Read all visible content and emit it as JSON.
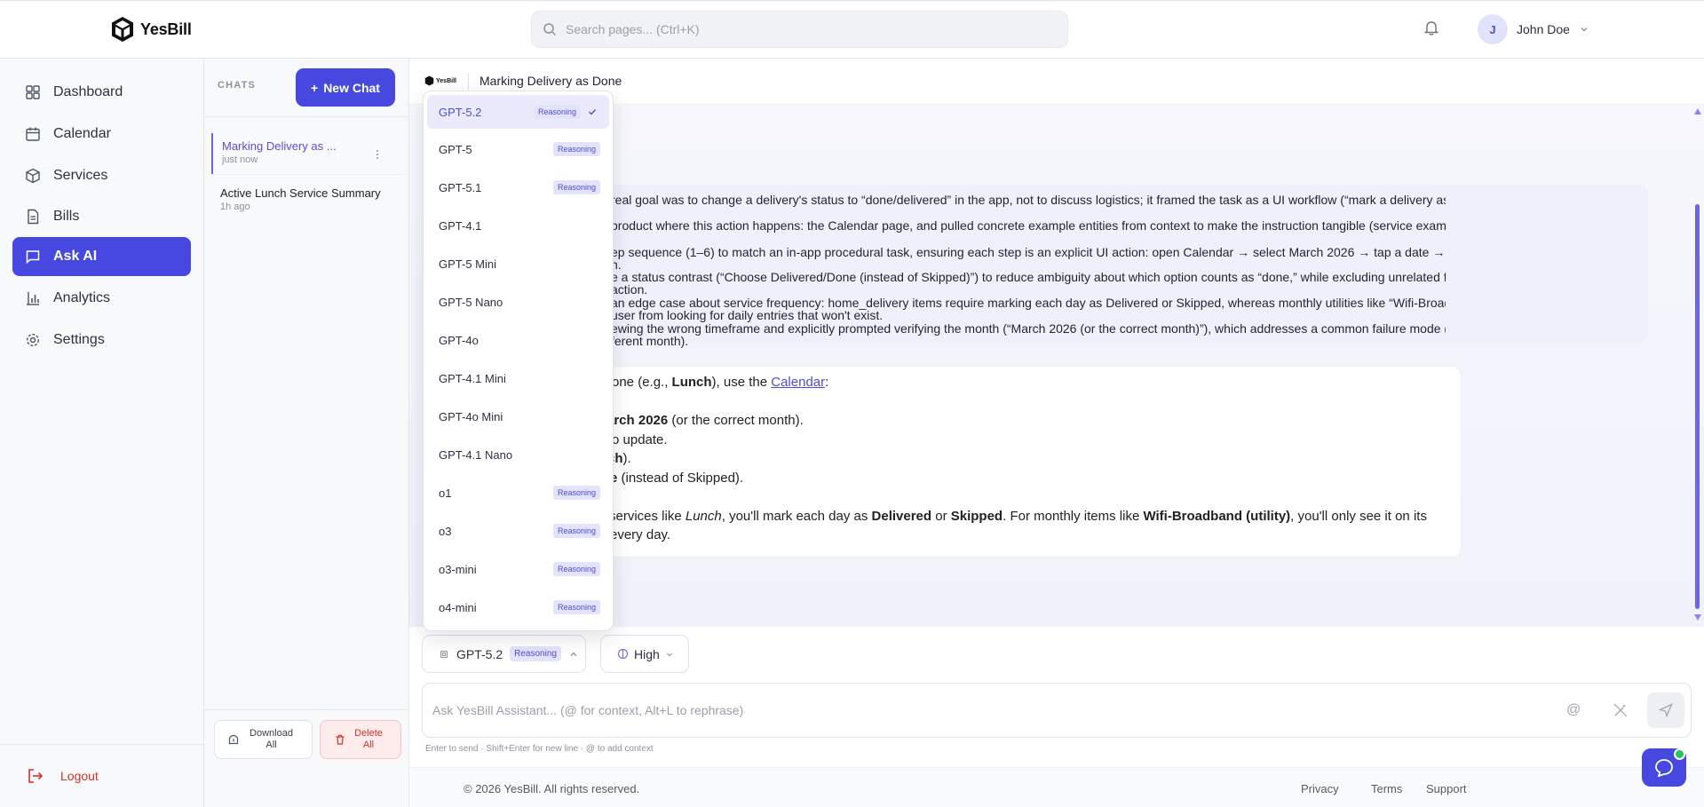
{
  "brand": {
    "name": "YesBill"
  },
  "search": {
    "placeholder": "Search pages... (Ctrl+K)"
  },
  "user": {
    "initial": "J",
    "name": "John Doe"
  },
  "sidebar": {
    "items": [
      {
        "label": "Dashboard",
        "icon": "dashboard-icon"
      },
      {
        "label": "Calendar",
        "icon": "calendar-icon"
      },
      {
        "label": "Services",
        "icon": "box-icon"
      },
      {
        "label": "Bills",
        "icon": "file-icon"
      },
      {
        "label": "Ask AI",
        "icon": "chat-icon",
        "active": true
      },
      {
        "label": "Analytics",
        "icon": "bar-chart-icon"
      },
      {
        "label": "Settings",
        "icon": "gear-icon"
      }
    ],
    "logout_label": "Logout"
  },
  "chatlist": {
    "label": "CHATS",
    "new_chat_label": "New Chat",
    "items": [
      {
        "title": "Marking Delivery as ...",
        "time": "just now",
        "active": true
      },
      {
        "title": "Active Lunch Service Summary",
        "time": "1h ago"
      }
    ],
    "download_label": "Download All",
    "delete_label": "Delete All"
  },
  "conversation": {
    "mini_logo": "YesBill",
    "title": "Marking Delivery as Done",
    "reasoning_lines": [
      "real goal was to change a delivery's status to “done/delivered” in the app, not to discuss logistics; it framed the task as a UI workflow (“mark a delivery as done”) rather than a general",
      "product where this action happens: the Calendar page, and pulled concrete example entities from context to make the instruction tangible (service example “Lunch” and category",
      "ep sequence (1–6) to match an in-app procedural task, ensuring each step is an explicit UI action: open Calendar → select March 2026 → tap a date → select Lunch → choose",
      "n.",
      "e a status contrast (“Choose Delivered/Done (instead of Skipped)”) to reduce ambiguity about which option counts as “done,” while excluding unrelated features/settings that aren't",
      "action.",
      "an edge case about service frequency: home_delivery items require marking each day as Delivered or Skipped, whereas monthly utilities like “Wifi-Broadband (utility)” appear only on",
      "user from looking for daily entries that won't exist.",
      "ewing the wrong timeframe and explicitly prompted verifying the month (“March 2026 (or the correct month)”), which addresses a common failure mode (not seeing the delivery",
      "ferent month)."
    ],
    "answer": {
      "line1_pre": "one (e.g., ",
      "line1_bold": "Lunch",
      "line1_mid": "), use the ",
      "line1_link": "Calendar",
      "line1_post": ":",
      "line2_bold": "arch 2026",
      "line2_post": " (or the correct month).",
      "line3": "o update.",
      "line4_bold": "ch",
      "line4_post": ").",
      "line5_bold": "e",
      "line5_post": " (instead of Skipped).",
      "line6_pre": " services like ",
      "line6_em": "Lunch",
      "line6_mid": ", you'll mark each day as ",
      "line6_b1": "Delivered",
      "line6_or": " or ",
      "line6_b2": "Skipped",
      "line6_mid2": ". For monthly items like ",
      "line6_b3": "Wifi-Broadband (utility)",
      "line6_post": ", you'll only see it on its",
      "line7": "every day."
    }
  },
  "model_menu": {
    "items": [
      {
        "label": "GPT-5.2",
        "badge": "Reasoning",
        "selected": true
      },
      {
        "label": "GPT-5",
        "badge": "Reasoning"
      },
      {
        "label": "GPT-5.1",
        "badge": "Reasoning"
      },
      {
        "label": "GPT-4.1",
        "badge": ""
      },
      {
        "label": "GPT-5 Mini",
        "badge": ""
      },
      {
        "label": "GPT-5 Nano",
        "badge": ""
      },
      {
        "label": "GPT-4o",
        "badge": ""
      },
      {
        "label": "GPT-4.1 Mini",
        "badge": ""
      },
      {
        "label": "GPT-4o Mini",
        "badge": ""
      },
      {
        "label": "GPT-4.1 Nano",
        "badge": ""
      },
      {
        "label": "o1",
        "badge": "Reasoning"
      },
      {
        "label": "o3",
        "badge": "Reasoning"
      },
      {
        "label": "o3-mini",
        "badge": "Reasoning"
      },
      {
        "label": "o4-mini",
        "badge": "Reasoning"
      }
    ]
  },
  "composer": {
    "model_label": "GPT-5.2",
    "model_badge": "Reasoning",
    "effort_label": "High",
    "placeholder": "Ask YesBill Assistant... (@ for context, Alt+L to rephrase)",
    "at_symbol": "@",
    "hint": "Enter to send · Shift+Enter for new line · @ to add context"
  },
  "footer": {
    "copyright": "© 2026 YesBill. All rights reserved.",
    "privacy": "Privacy",
    "terms": "Terms",
    "support": "Support"
  },
  "colors": {
    "accent": "#4648e0",
    "danger": "#d4322c",
    "online": "#22c55e"
  }
}
